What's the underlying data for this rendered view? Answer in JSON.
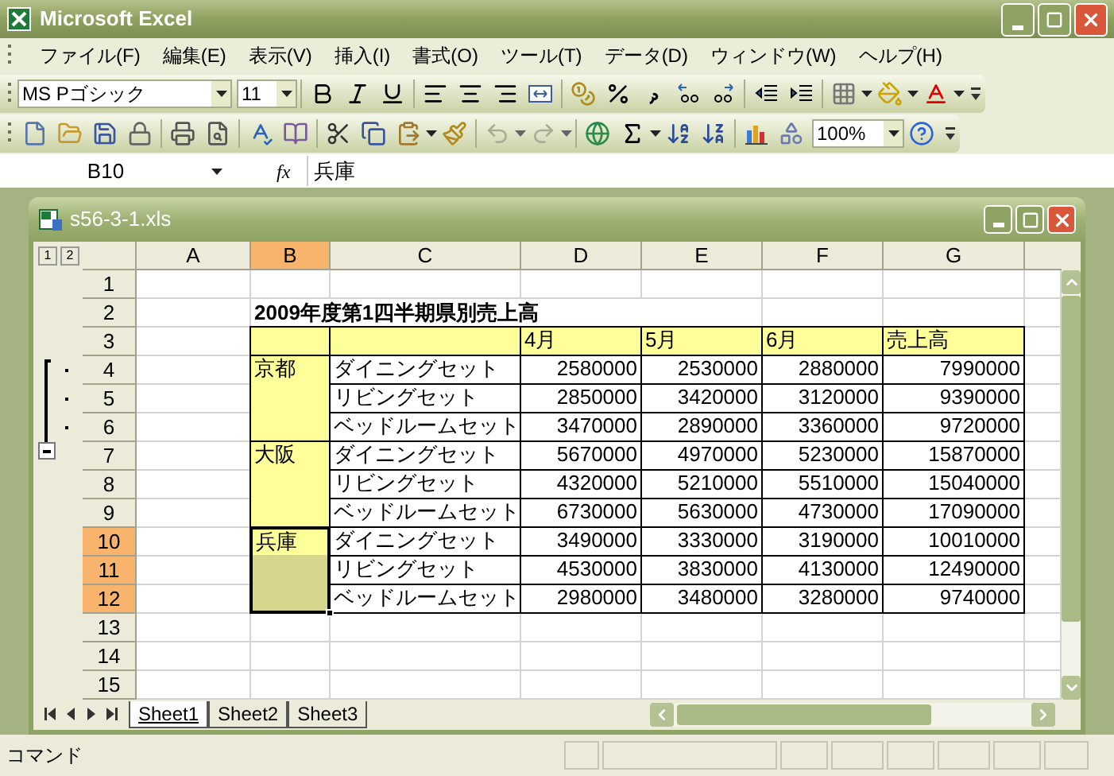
{
  "window": {
    "title": "Microsoft Excel"
  },
  "menu": [
    {
      "label": "ファイル(F)"
    },
    {
      "label": "編集(E)"
    },
    {
      "label": "表示(V)"
    },
    {
      "label": "挿入(I)"
    },
    {
      "label": "書式(O)"
    },
    {
      "label": "ツール(T)"
    },
    {
      "label": "データ(D)"
    },
    {
      "label": "ウィンドウ(W)"
    },
    {
      "label": "ヘルプ(H)"
    }
  ],
  "formatting_toolbar": {
    "font": "MS Pゴシック",
    "size": "11"
  },
  "standard_toolbar": {
    "zoom": "100%"
  },
  "formula_bar": {
    "name_box": "B10",
    "function_label": "fx",
    "value": "兵庫"
  },
  "workbook": {
    "title": "s56-3-1.xls",
    "outline_levels": [
      "1",
      "2"
    ],
    "columns": [
      {
        "label": "A",
        "selected": false
      },
      {
        "label": "B",
        "selected": true
      },
      {
        "label": "C",
        "selected": false
      },
      {
        "label": "D",
        "selected": false
      },
      {
        "label": "E",
        "selected": false
      },
      {
        "label": "F",
        "selected": false
      },
      {
        "label": "G",
        "selected": false
      }
    ],
    "rows": [
      {
        "label": "1",
        "selected": false
      },
      {
        "label": "2",
        "selected": false
      },
      {
        "label": "3",
        "selected": false
      },
      {
        "label": "4",
        "selected": false
      },
      {
        "label": "5",
        "selected": false
      },
      {
        "label": "6",
        "selected": false
      },
      {
        "label": "7",
        "selected": false
      },
      {
        "label": "8",
        "selected": false
      },
      {
        "label": "9",
        "selected": false
      },
      {
        "label": "10",
        "selected": true
      },
      {
        "label": "11",
        "selected": true
      },
      {
        "label": "12",
        "selected": true
      },
      {
        "label": "13",
        "selected": false
      },
      {
        "label": "14",
        "selected": false
      },
      {
        "label": "15",
        "selected": false
      }
    ],
    "report": {
      "title": "2009年度第1四半期県別売上高",
      "headers": [
        "4月",
        "5月",
        "6月",
        "売上高"
      ],
      "groups": [
        {
          "region": "京都",
          "selected": false,
          "items": [
            {
              "product": "ダイニングセット",
              "values": [
                "2580000",
                "2530000",
                "2880000",
                "7990000"
              ]
            },
            {
              "product": "リビングセット",
              "values": [
                "2850000",
                "3420000",
                "3120000",
                "9390000"
              ]
            },
            {
              "product": "ベッドルームセット",
              "values": [
                "3470000",
                "2890000",
                "3360000",
                "9720000"
              ]
            }
          ]
        },
        {
          "region": "大阪",
          "selected": false,
          "items": [
            {
              "product": "ダイニングセット",
              "values": [
                "5670000",
                "4970000",
                "5230000",
                "15870000"
              ]
            },
            {
              "product": "リビングセット",
              "values": [
                "4320000",
                "5210000",
                "5510000",
                "15040000"
              ]
            },
            {
              "product": "ベッドルームセット",
              "values": [
                "6730000",
                "5630000",
                "4730000",
                "17090000"
              ]
            }
          ]
        },
        {
          "region": "兵庫",
          "selected": true,
          "items": [
            {
              "product": "ダイニングセット",
              "values": [
                "3490000",
                "3330000",
                "3190000",
                "10010000"
              ]
            },
            {
              "product": "リビングセット",
              "values": [
                "4530000",
                "3830000",
                "4130000",
                "12490000"
              ]
            },
            {
              "product": "ベッドルームセット",
              "values": [
                "2980000",
                "3480000",
                "3280000",
                "9740000"
              ]
            }
          ]
        }
      ]
    },
    "sheet_tabs": [
      {
        "label": "Sheet1",
        "selected": true
      },
      {
        "label": "Sheet2",
        "selected": false
      },
      {
        "label": "Sheet3",
        "selected": false
      }
    ]
  },
  "status_bar": {
    "text": "コマンド"
  }
}
